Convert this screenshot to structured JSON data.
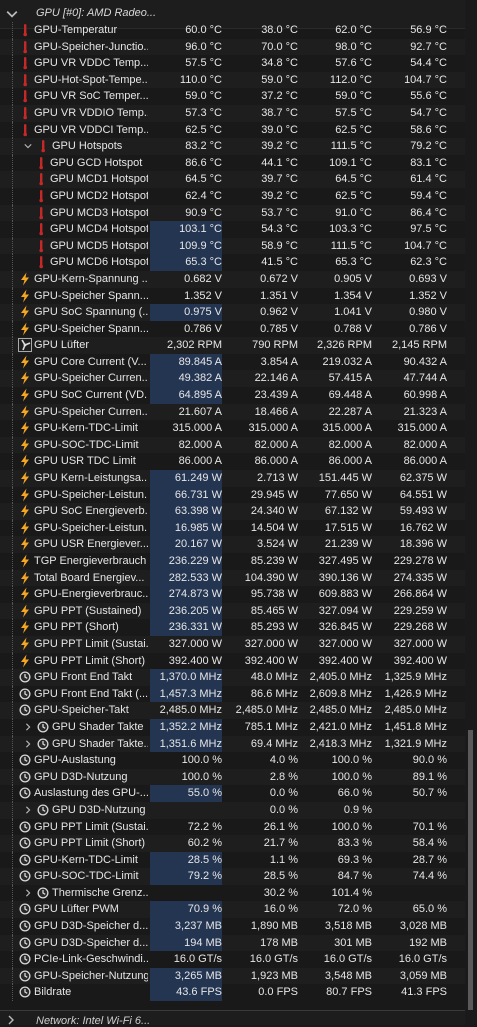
{
  "header": {
    "title": "GPU [#0]: AMD Radeo..."
  },
  "footer": {
    "title": "Network: Intel Wi-Fi 6..."
  },
  "rows": [
    {
      "label": "GPU-Temperatur",
      "icon": "thermometer-icon",
      "v": [
        "60.0 °C",
        "38.0 °C",
        "62.0 °C",
        "56.9 °C"
      ],
      "indent": 0
    },
    {
      "label": "GPU-Speicher-Junctio...",
      "icon": "thermometer-icon",
      "v": [
        "96.0 °C",
        "70.0 °C",
        "98.0 °C",
        "92.7 °C"
      ],
      "indent": 0
    },
    {
      "label": "GPU VR VDDC Temp...",
      "icon": "thermometer-icon",
      "v": [
        "57.5 °C",
        "34.8 °C",
        "57.6 °C",
        "54.4 °C"
      ],
      "indent": 0
    },
    {
      "label": "GPU-Hot-Spot-Tempe...",
      "icon": "thermometer-icon",
      "v": [
        "110.0 °C",
        "59.0 °C",
        "112.0 °C",
        "104.7 °C"
      ],
      "indent": 0
    },
    {
      "label": "GPU VR SoC Temper...",
      "icon": "thermometer-icon",
      "v": [
        "59.0 °C",
        "37.2 °C",
        "59.0 °C",
        "55.6 °C"
      ],
      "indent": 0
    },
    {
      "label": "GPU VR VDDIO Temp...",
      "icon": "thermometer-icon",
      "v": [
        "57.3 °C",
        "38.7 °C",
        "57.5 °C",
        "54.7 °C"
      ],
      "indent": 0
    },
    {
      "label": "GPU VR VDDCI Temp...",
      "icon": "thermometer-icon",
      "v": [
        "62.5 °C",
        "39.0 °C",
        "62.5 °C",
        "58.6 °C"
      ],
      "indent": 0
    },
    {
      "label": "GPU Hotspots",
      "icon": "thermometer-icon",
      "v": [
        "83.2 °C",
        "39.2 °C",
        "111.5 °C",
        "79.2 °C"
      ],
      "indent": 1,
      "expand": "open"
    },
    {
      "label": "GPU GCD Hotspot",
      "icon": "thermometer-icon",
      "v": [
        "86.6 °C",
        "44.1 °C",
        "109.1 °C",
        "83.1 °C"
      ],
      "indent": 2
    },
    {
      "label": "GPU MCD1 Hotspot",
      "icon": "thermometer-icon",
      "v": [
        "64.5 °C",
        "39.7 °C",
        "64.5 °C",
        "61.4 °C"
      ],
      "indent": 2
    },
    {
      "label": "GPU MCD2 Hotspot",
      "icon": "thermometer-icon",
      "v": [
        "62.4 °C",
        "39.2 °C",
        "62.5 °C",
        "59.4 °C"
      ],
      "indent": 2
    },
    {
      "label": "GPU MCD3 Hotspot",
      "icon": "thermometer-icon",
      "v": [
        "90.9 °C",
        "53.7 °C",
        "91.0 °C",
        "86.4 °C"
      ],
      "indent": 2
    },
    {
      "label": "GPU MCD4 Hotspot",
      "icon": "thermometer-icon",
      "v": [
        "103.1 °C",
        "54.3 °C",
        "103.3 °C",
        "97.5 °C"
      ],
      "indent": 2,
      "hl": true
    },
    {
      "label": "GPU MCD5 Hotspot",
      "icon": "thermometer-icon",
      "v": [
        "109.9 °C",
        "58.9 °C",
        "111.5 °C",
        "104.7 °C"
      ],
      "indent": 2,
      "hl": true
    },
    {
      "label": "GPU MCD6 Hotspot",
      "icon": "thermometer-icon",
      "v": [
        "65.3 °C",
        "41.5 °C",
        "65.3 °C",
        "62.3 °C"
      ],
      "indent": 2,
      "hl": true
    },
    {
      "label": "GPU-Kern-Spannung ...",
      "icon": "lightning-icon",
      "v": [
        "0.682 V",
        "0.672 V",
        "0.905 V",
        "0.693 V"
      ],
      "indent": 0
    },
    {
      "label": "GPU-Speicher Spann...",
      "icon": "lightning-icon",
      "v": [
        "1.352 V",
        "1.351 V",
        "1.354 V",
        "1.352 V"
      ],
      "indent": 0
    },
    {
      "label": "GPU SoC Spannung (...",
      "icon": "lightning-icon",
      "v": [
        "0.975 V",
        "0.962 V",
        "1.041 V",
        "0.980 V"
      ],
      "indent": 0,
      "hl": true
    },
    {
      "label": "GPU-Speicher Spann...",
      "icon": "lightning-icon",
      "v": [
        "0.786 V",
        "0.785 V",
        "0.788 V",
        "0.786 V"
      ],
      "indent": 0
    },
    {
      "label": "GPU Lüfter",
      "icon": "fan-icon",
      "v": [
        "2,302 RPM",
        "790 RPM",
        "2,326 RPM",
        "2,145 RPM"
      ],
      "indent": 0
    },
    {
      "label": "GPU Core Current (V...",
      "icon": "lightning-icon",
      "v": [
        "89.845 A",
        "3.854 A",
        "219.032 A",
        "90.432 A"
      ],
      "indent": 0,
      "hl": true
    },
    {
      "label": "GPU-Speicher Curren...",
      "icon": "lightning-icon",
      "v": [
        "49.382 A",
        "22.146 A",
        "57.415 A",
        "47.744 A"
      ],
      "indent": 0,
      "hl": true
    },
    {
      "label": "GPU SoC Current (VD...",
      "icon": "lightning-icon",
      "v": [
        "64.895 A",
        "23.439 A",
        "69.448 A",
        "60.998 A"
      ],
      "indent": 0,
      "hl": true
    },
    {
      "label": "GPU-Speicher Curren...",
      "icon": "lightning-icon",
      "v": [
        "21.607 A",
        "18.466 A",
        "22.287 A",
        "21.323 A"
      ],
      "indent": 0
    },
    {
      "label": "GPU-Kern-TDC-Limit",
      "icon": "lightning-icon",
      "v": [
        "315.000 A",
        "315.000 A",
        "315.000 A",
        "315.000 A"
      ],
      "indent": 0
    },
    {
      "label": "GPU-SOC-TDC-Limit",
      "icon": "lightning-icon",
      "v": [
        "82.000 A",
        "82.000 A",
        "82.000 A",
        "82.000 A"
      ],
      "indent": 0
    },
    {
      "label": "GPU USR TDC Limit",
      "icon": "lightning-icon",
      "v": [
        "86.000 A",
        "86.000 A",
        "86.000 A",
        "86.000 A"
      ],
      "indent": 0
    },
    {
      "label": "GPU Kern-Leistungsa...",
      "icon": "lightning-icon",
      "v": [
        "61.249 W",
        "2.713 W",
        "151.445 W",
        "62.375 W"
      ],
      "indent": 0,
      "hl": true
    },
    {
      "label": "GPU-Speicher-Leistun...",
      "icon": "lightning-icon",
      "v": [
        "66.731 W",
        "29.945 W",
        "77.650 W",
        "64.551 W"
      ],
      "indent": 0,
      "hl": true
    },
    {
      "label": "GPU SoC Energieverb...",
      "icon": "lightning-icon",
      "v": [
        "63.398 W",
        "24.340 W",
        "67.132 W",
        "59.493 W"
      ],
      "indent": 0,
      "hl": true
    },
    {
      "label": "GPU-Speicher-Leistun...",
      "icon": "lightning-icon",
      "v": [
        "16.985 W",
        "14.504 W",
        "17.515 W",
        "16.762 W"
      ],
      "indent": 0,
      "hl": true
    },
    {
      "label": "GPU USR Energiever...",
      "icon": "lightning-icon",
      "v": [
        "20.167 W",
        "3.524 W",
        "21.239 W",
        "18.396 W"
      ],
      "indent": 0,
      "hl": true
    },
    {
      "label": "TGP Energieverbrauch",
      "icon": "lightning-icon",
      "v": [
        "236.229 W",
        "85.239 W",
        "327.495 W",
        "229.278 W"
      ],
      "indent": 0,
      "hl": true
    },
    {
      "label": "Total Board Energiev...",
      "icon": "lightning-icon",
      "v": [
        "282.533 W",
        "104.390 W",
        "390.136 W",
        "274.335 W"
      ],
      "indent": 0,
      "hl": true
    },
    {
      "label": "GPU-Energieverbrauc...",
      "icon": "lightning-icon",
      "v": [
        "274.873 W",
        "95.738 W",
        "609.883 W",
        "266.864 W"
      ],
      "indent": 0,
      "hl": true
    },
    {
      "label": "GPU PPT (Sustained)",
      "icon": "lightning-icon",
      "v": [
        "236.205 W",
        "85.465 W",
        "327.094 W",
        "229.259 W"
      ],
      "indent": 0,
      "hl": true
    },
    {
      "label": "GPU PPT (Short)",
      "icon": "lightning-icon",
      "v": [
        "236.331 W",
        "85.293 W",
        "326.845 W",
        "229.268 W"
      ],
      "indent": 0,
      "hl": true
    },
    {
      "label": "GPU PPT Limit (Sustai...",
      "icon": "lightning-icon",
      "v": [
        "327.000 W",
        "327.000 W",
        "327.000 W",
        "327.000 W"
      ],
      "indent": 0
    },
    {
      "label": "GPU PPT Limit (Short)",
      "icon": "lightning-icon",
      "v": [
        "392.400 W",
        "392.400 W",
        "392.400 W",
        "392.400 W"
      ],
      "indent": 0
    },
    {
      "label": "GPU Front End Takt",
      "icon": "clock-icon",
      "v": [
        "1,370.0 MHz",
        "48.0 MHz",
        "2,405.0 MHz",
        "1,325.9 MHz"
      ],
      "indent": 0,
      "hl": true
    },
    {
      "label": "GPU Front End Takt (...",
      "icon": "clock-icon",
      "v": [
        "1,457.3 MHz",
        "86.6 MHz",
        "2,609.8 MHz",
        "1,426.9 MHz"
      ],
      "indent": 0,
      "hl": true
    },
    {
      "label": "GPU-Speicher-Takt",
      "icon": "clock-icon",
      "v": [
        "2,485.0 MHz",
        "2,485.0 MHz",
        "2,485.0 MHz",
        "2,485.0 MHz"
      ],
      "indent": 0
    },
    {
      "label": "GPU Shader Takte",
      "icon": "clock-icon",
      "v": [
        "1,352.2 MHz",
        "785.1 MHz",
        "2,421.0 MHz",
        "1,451.8 MHz"
      ],
      "indent": 1,
      "expand": "closed",
      "hl": true
    },
    {
      "label": "GPU Shader Takte...",
      "icon": "clock-icon",
      "v": [
        "1,351.6 MHz",
        "69.4 MHz",
        "2,418.3 MHz",
        "1,321.9 MHz"
      ],
      "indent": 1,
      "expand": "closed",
      "hl": true
    },
    {
      "label": "GPU-Auslastung",
      "icon": "clock-icon",
      "v": [
        "100.0 %",
        "4.0 %",
        "100.0 %",
        "90.0 %"
      ],
      "indent": 0
    },
    {
      "label": "GPU D3D-Nutzung",
      "icon": "clock-icon",
      "v": [
        "100.0 %",
        "2.8 %",
        "100.0 %",
        "89.1 %"
      ],
      "indent": 0
    },
    {
      "label": "Auslastung des GPU-...",
      "icon": "clock-icon",
      "v": [
        "55.0 %",
        "0.0 %",
        "66.0 %",
        "50.7 %"
      ],
      "indent": 0,
      "hl": true
    },
    {
      "label": "GPU D3D-Nutzung",
      "icon": "clock-icon",
      "v": [
        "",
        "0.0 %",
        "0.9 %",
        ""
      ],
      "indent": 1,
      "expand": "closed",
      "hl": true
    },
    {
      "label": "GPU PPT Limit (Sustai...",
      "icon": "clock-icon",
      "v": [
        "72.2 %",
        "26.1 %",
        "100.0 %",
        "70.1 %"
      ],
      "indent": 0
    },
    {
      "label": "GPU PPT Limit (Short)",
      "icon": "clock-icon",
      "v": [
        "60.2 %",
        "21.7 %",
        "83.3 %",
        "58.4 %"
      ],
      "indent": 0
    },
    {
      "label": "GPU-Kern-TDC-Limit",
      "icon": "clock-icon",
      "v": [
        "28.5 %",
        "1.1 %",
        "69.3 %",
        "28.7 %"
      ],
      "indent": 0,
      "hl": true
    },
    {
      "label": "GPU-SOC-TDC-Limit",
      "icon": "clock-icon",
      "v": [
        "79.2 %",
        "28.5 %",
        "84.7 %",
        "74.4 %"
      ],
      "indent": 0,
      "hl": true
    },
    {
      "label": "Thermische Grenz...",
      "icon": "clock-icon",
      "v": [
        "",
        "30.2 %",
        "101.4 %",
        ""
      ],
      "indent": 1,
      "expand": "closed",
      "hl": true
    },
    {
      "label": "GPU Lüfter PWM",
      "icon": "clock-icon",
      "v": [
        "70.9 %",
        "16.0 %",
        "72.0 %",
        "65.0 %"
      ],
      "indent": 0,
      "hl": true
    },
    {
      "label": "GPU D3D-Speicher d...",
      "icon": "clock-icon",
      "v": [
        "3,237 MB",
        "1,890 MB",
        "3,518 MB",
        "3,028 MB"
      ],
      "indent": 0,
      "hl": true
    },
    {
      "label": "GPU D3D-Speicher d...",
      "icon": "clock-icon",
      "v": [
        "194 MB",
        "178 MB",
        "301 MB",
        "192 MB"
      ],
      "indent": 0,
      "hl": true
    },
    {
      "label": "PCIe-Link-Geschwindi...",
      "icon": "clock-icon",
      "v": [
        "16.0 GT/s",
        "16.0 GT/s",
        "16.0 GT/s",
        "16.0 GT/s"
      ],
      "indent": 0
    },
    {
      "label": "GPU-Speicher-Nutzung",
      "icon": "clock-icon",
      "v": [
        "3,265 MB",
        "1,923 MB",
        "3,548 MB",
        "3,059 MB"
      ],
      "indent": 0,
      "hl": true
    },
    {
      "label": "Bildrate",
      "icon": "clock-icon",
      "v": [
        "43.6 FPS",
        "0.0 FPS",
        "80.7 FPS",
        "41.3 FPS"
      ],
      "indent": 0,
      "hl": true
    }
  ],
  "colors": {
    "thermometer": "#c62828",
    "lightning": "#f5a623",
    "clock": "#cfcfcf",
    "highlight": "#243552"
  }
}
